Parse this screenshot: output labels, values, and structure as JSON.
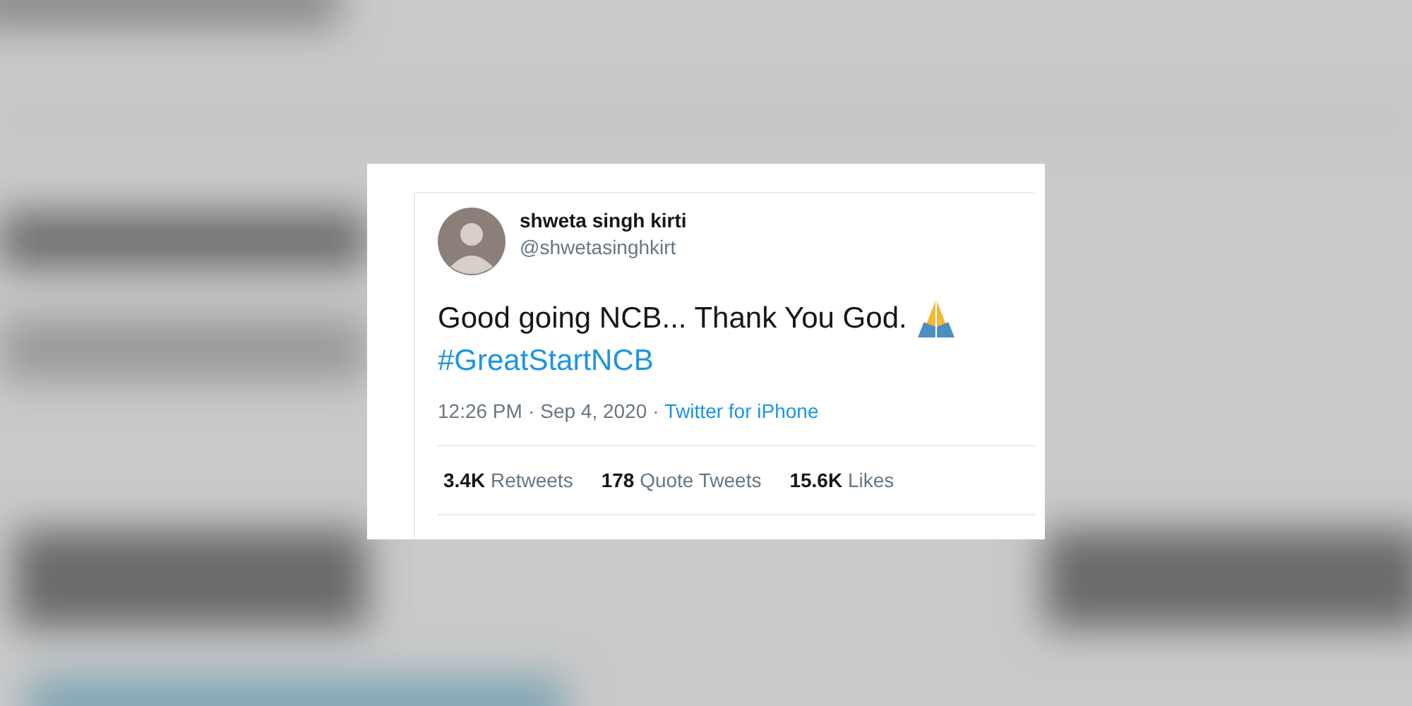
{
  "tweet": {
    "author": {
      "name": "shweta singh kirti",
      "handle": "@shwetasinghkirt"
    },
    "text": "Good going NCB... Thank You God.",
    "hashtag": "#GreatStartNCB",
    "separator": "·",
    "time": "12:26 PM",
    "date": "Sep 4, 2020",
    "source": "Twitter for iPhone",
    "stats": [
      {
        "count": "3.4K",
        "label": "Retweets"
      },
      {
        "count": "178",
        "label": "Quote Tweets"
      },
      {
        "count": "15.6K",
        "label": "Likes"
      }
    ]
  }
}
